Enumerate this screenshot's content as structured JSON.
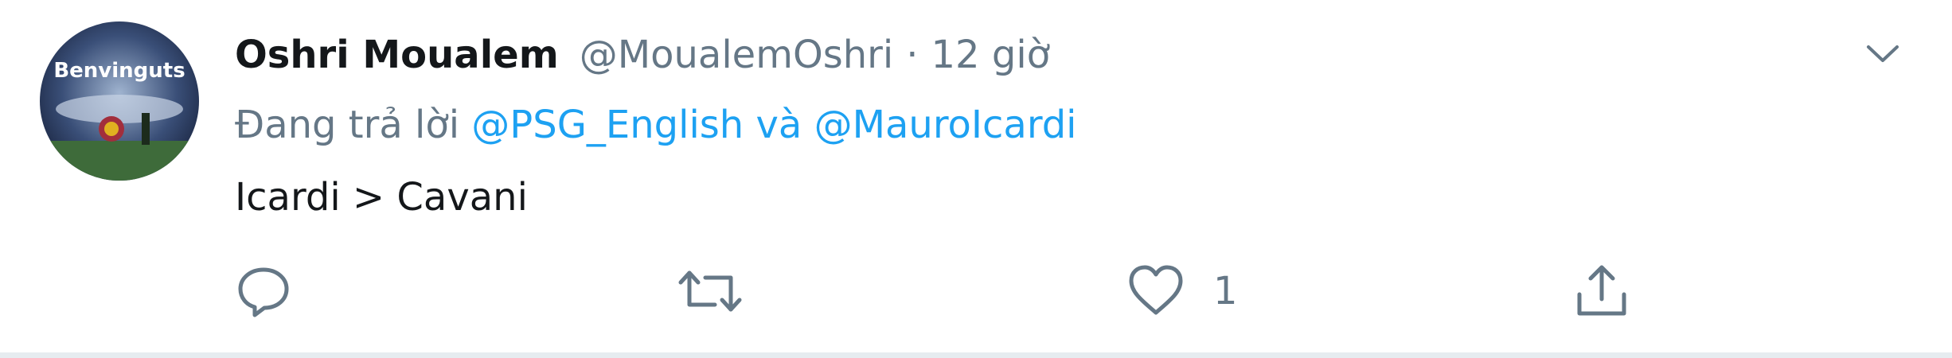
{
  "tweet": {
    "display_name": "Oshri Moualem",
    "handle": "@MoualemOshri",
    "separator": "·",
    "time": "12 giờ",
    "avatar_text": "Benvinguts",
    "reply": {
      "prefix": "Đang trả lời ",
      "mention_1": "@PSG_English",
      "conjunction": " và ",
      "mention_2": "@MauroIcardi"
    },
    "text": "Icardi > Cavani",
    "actions": {
      "reply_count": "",
      "retweet_count": "",
      "like_count": "1"
    }
  },
  "icons": {
    "caret": "chevron-down-icon",
    "reply": "reply-icon",
    "retweet": "retweet-icon",
    "like": "heart-icon",
    "share": "share-icon"
  },
  "colors": {
    "link": "#1da1f2",
    "secondary_text": "#657786",
    "primary_text": "#14171a",
    "border": "#e6ecf0"
  }
}
